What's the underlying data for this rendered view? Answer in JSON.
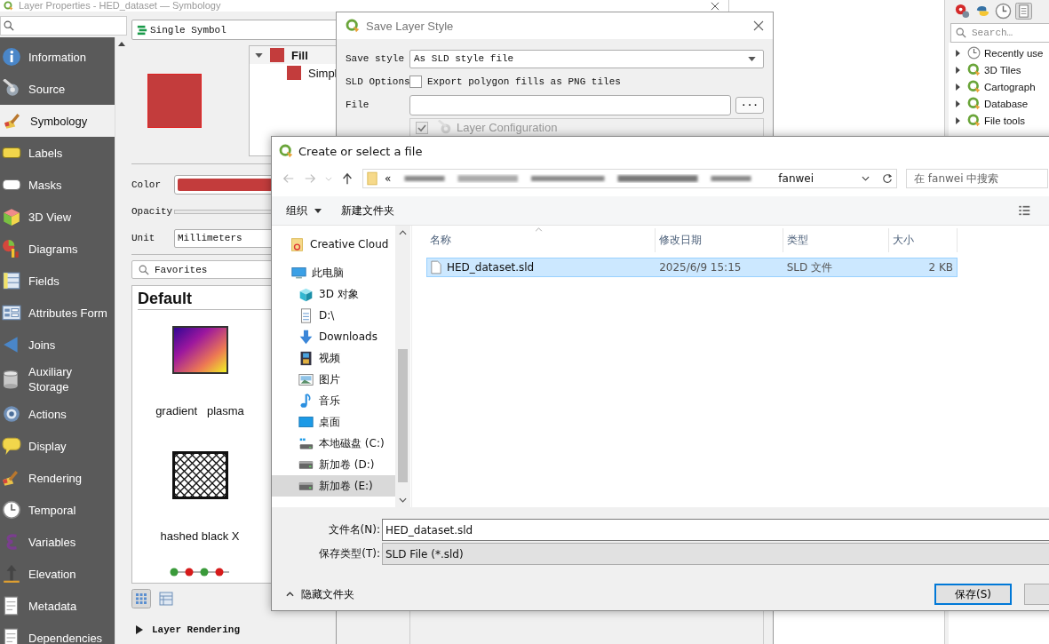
{
  "layer_properties": {
    "title": "Layer Properties - HED_dataset — Symbology",
    "sidebar": {
      "items": [
        {
          "label": "Information",
          "kind": "info",
          "selected": false
        },
        {
          "label": "Source",
          "kind": "wrench",
          "selected": false
        },
        {
          "label": "Symbology",
          "kind": "brush",
          "selected": true
        },
        {
          "label": "Labels",
          "kind": "tag",
          "selected": false
        },
        {
          "label": "Masks",
          "kind": "outline-tag",
          "selected": false
        },
        {
          "label": "3D View",
          "kind": "cube",
          "selected": false
        },
        {
          "label": "Diagrams",
          "kind": "chart",
          "selected": false
        },
        {
          "label": "Fields",
          "kind": "table",
          "selected": false
        },
        {
          "label": "Attributes Form",
          "kind": "form",
          "selected": false
        },
        {
          "label": "Joins",
          "kind": "triangle",
          "selected": false
        },
        {
          "label": "Auxiliary Storage",
          "kind": "database",
          "selected": false
        },
        {
          "label": "Actions",
          "kind": "gear",
          "selected": false
        },
        {
          "label": "Display",
          "kind": "bubble",
          "selected": false
        },
        {
          "label": "Rendering",
          "kind": "brush",
          "selected": false
        },
        {
          "label": "Temporal",
          "kind": "clock",
          "selected": false
        },
        {
          "label": "Variables",
          "kind": "curve",
          "selected": false
        },
        {
          "label": "Elevation",
          "kind": "elevation",
          "selected": false
        },
        {
          "label": "Metadata",
          "kind": "document",
          "selected": false
        },
        {
          "label": "Dependencies",
          "kind": "document",
          "selected": false
        }
      ]
    },
    "renderer": "Single Symbol",
    "symbol_tree": [
      {
        "label": "Fill",
        "selected": true
      },
      {
        "label": "Simpl",
        "selected": false
      }
    ],
    "color_label": "Color",
    "opacity_label": "Opacity",
    "unit_label": "Unit",
    "unit": "Millimeters",
    "library_search": "Favorites",
    "library_title": "Default",
    "symbols": [
      {
        "label": "gradient   plasma",
        "kind": "gradient"
      },
      {
        "label": "hashed black X",
        "kind": "hatch"
      },
      {
        "kind": "dots"
      }
    ],
    "section": "Layer Rendering"
  },
  "save_layer_style": {
    "title": "Save Layer Style",
    "save_style_label": "Save style",
    "save_style": "As SLD style file",
    "sld_options_label": "SLD Options",
    "export_png": {
      "label": "Export polygon fills as PNG tiles",
      "checked": false
    },
    "file_label": "File",
    "browse": "···",
    "layer_configuration": {
      "label": "Layer Configuration",
      "checked": true
    }
  },
  "file_dialog": {
    "title": "Create or select a file",
    "path_start": "«",
    "path_end": "fanwei",
    "search_placeholder": "在 fanwei 中搜索",
    "organize": "组织",
    "new_folder": "新建文件夹",
    "nav": [
      {
        "label": "Creative Cloud",
        "kind": "cloud",
        "selected": false
      },
      {
        "label": "此电脑",
        "kind": "pc",
        "selected": false,
        "children": [
          {
            "label": "3D 对象",
            "kind": "cube3d",
            "selected": false
          },
          {
            "label": "D:\\",
            "kind": "doc",
            "selected": false
          },
          {
            "label": "Downloads",
            "kind": "download",
            "selected": false
          },
          {
            "label": "视频",
            "kind": "video",
            "selected": false
          },
          {
            "label": "图片",
            "kind": "image",
            "selected": false
          },
          {
            "label": "音乐",
            "kind": "music",
            "selected": false
          },
          {
            "label": "桌面",
            "kind": "desktop",
            "selected": false
          },
          {
            "label": "本地磁盘 (C:)",
            "kind": "windrive",
            "selected": false
          },
          {
            "label": "新加卷 (D:)",
            "kind": "drive",
            "selected": false
          },
          {
            "label": "新加卷 (E:)",
            "kind": "drive",
            "selected": true
          }
        ]
      }
    ],
    "columns": [
      "名称",
      "修改日期",
      "类型",
      "大小"
    ],
    "rows": [
      {
        "name": "HED_dataset.sld",
        "modified": "2025/6/9 15:15",
        "type": "SLD 文件",
        "size": "2 KB",
        "selected": true
      }
    ],
    "file_name_label": "文件名(N):",
    "file_name": "HED_dataset.sld",
    "save_type_label": "保存类型(T):",
    "save_type": "SLD File (*.sld)",
    "hide_folders": "隐藏文件夹",
    "save_button": "保存(S)"
  },
  "processing_toolbox": {
    "search_placeholder": "Search…",
    "items": [
      {
        "label": "Recently use",
        "kind": "history"
      },
      {
        "label": "3D Tiles",
        "kind": "provider"
      },
      {
        "label": "Cartograph",
        "kind": "provider"
      },
      {
        "label": "Database",
        "kind": "provider"
      },
      {
        "label": "File tools",
        "kind": "provider"
      }
    ]
  }
}
